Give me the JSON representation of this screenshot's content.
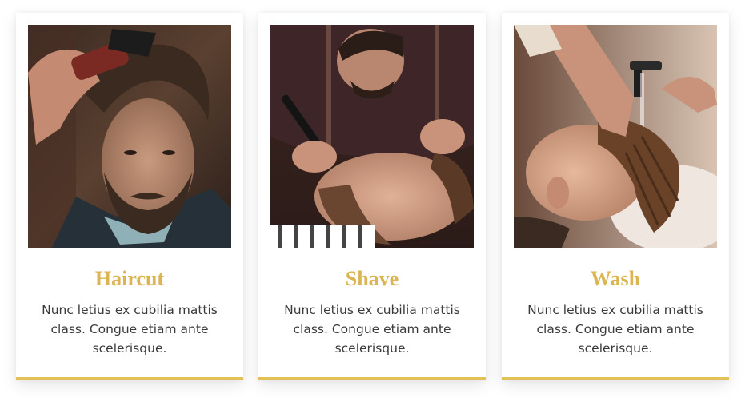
{
  "services": [
    {
      "title": "Haircut",
      "description": "Nunc letius ex cubilia mattis class. Congue etiam ante scelerisque.",
      "photo": "haircut-photo"
    },
    {
      "title": "Shave",
      "description": "Nunc letius ex cubilia mattis class. Congue etiam ante scelerisque.",
      "photo": "shave-photo"
    },
    {
      "title": "Wash",
      "description": "Nunc letius ex cubilia mattis class. Congue etiam ante scelerisque.",
      "photo": "wash-photo"
    }
  ],
  "colors": {
    "accent": "#e2c158",
    "title": "#dcb552",
    "text": "#3a3a3a"
  }
}
